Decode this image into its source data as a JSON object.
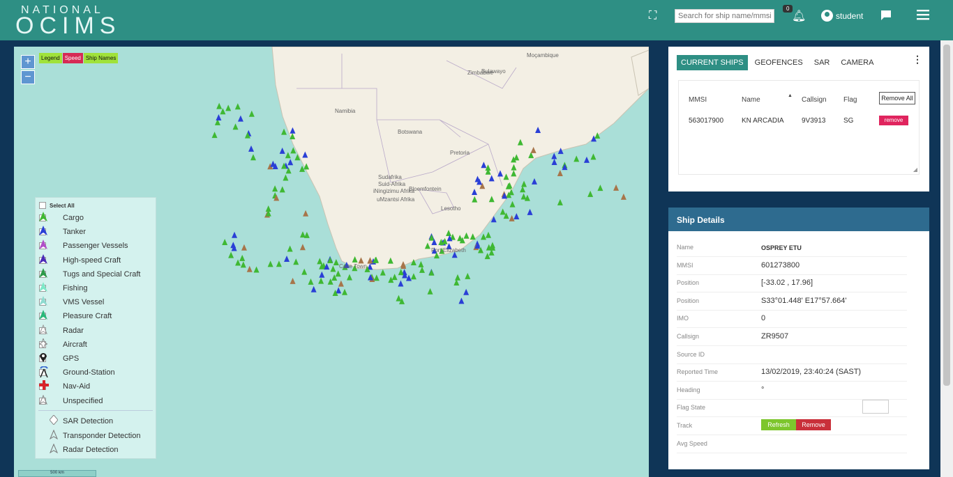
{
  "header": {
    "logo_top": "NATIONAL",
    "logo_main": "OCIMS",
    "search_placeholder": "Search for ship name/mmsi",
    "notification_count": "0",
    "user_name": "student",
    "colors": {
      "header": "#2e8f84",
      "sidebar": "#0f3557"
    }
  },
  "map": {
    "zoom_in": "+",
    "zoom_out": "−",
    "tags": {
      "legend": "Legend",
      "speed": "Speed",
      "ship_names": "Ship Names"
    },
    "scale": "500 km",
    "legend": {
      "select_all": "Select All",
      "items": [
        {
          "label": "Cargo",
          "color": "#3fb833",
          "icon": "triangle"
        },
        {
          "label": "Tanker",
          "color": "#2a3fd6",
          "icon": "triangle"
        },
        {
          "label": "Passenger Vessels",
          "color": "#b04fc8",
          "icon": "triangle"
        },
        {
          "label": "High-speed Craft",
          "color": "#4b2bb8",
          "icon": "triangle"
        },
        {
          "label": "Tugs and Special Craft",
          "color": "#2e9a4a",
          "icon": "triangle"
        },
        {
          "label": "Fishing",
          "color": "#7ee8c8",
          "icon": "triangle"
        },
        {
          "label": "VMS Vessel",
          "color": "#8fdbd0",
          "icon": "triangle"
        },
        {
          "label": "Pleasure Craft",
          "color": "#2ab87a",
          "icon": "triangle"
        },
        {
          "label": "Radar",
          "color": "#999999",
          "icon": "triangle-outline"
        },
        {
          "label": "Aircraft",
          "color": "#888888",
          "icon": "aircraft"
        },
        {
          "label": "GPS",
          "color": "#222222",
          "icon": "pin"
        },
        {
          "label": "Ground-Station",
          "color": "#3a6cd1",
          "icon": "antenna"
        },
        {
          "label": "Nav-Aid",
          "color": "#d8232a",
          "icon": "cross"
        },
        {
          "label": "Unspecified",
          "color": "#888888",
          "icon": "triangle-outline"
        }
      ],
      "detections": [
        {
          "label": "SAR Detection",
          "icon": "diamond"
        },
        {
          "label": "Transponder Detection",
          "icon": "triangle-outline"
        },
        {
          "label": "Radar Detection",
          "icon": "triangle-outline"
        }
      ]
    },
    "place_labels": [
      "Namibia",
      "Botswana",
      "Zimbabwe",
      "Moçambique",
      "Sudafrika",
      "Suid-Afrika",
      "iNingizimu Afrika",
      "uMzantsi Afrika",
      "Lesotho",
      "Pretoria",
      "Bloemfontein",
      "Bulawayo",
      "Port Elizabeth",
      "Cape Town"
    ]
  },
  "ships_panel": {
    "tabs": [
      "CURRENT SHIPS",
      "GEOFENCES",
      "SAR",
      "CAMERA"
    ],
    "columns": [
      "MMSI",
      "Name",
      "Callsign",
      "Flag"
    ],
    "remove_all": "Remove All",
    "rows": [
      {
        "mmsi": "563017900",
        "name": "KN ARCADIA",
        "callsign": "9V3913",
        "flag": "SG",
        "action": "remove"
      }
    ]
  },
  "details": {
    "title": "Ship Details",
    "fields": [
      {
        "label": "Name",
        "value": "OSPREY ETU"
      },
      {
        "label": "MMSI",
        "value": "601273800"
      },
      {
        "label": "Position",
        "value": "[-33.02 , 17.96]"
      },
      {
        "label": "Position",
        "value": "S33°01.448' E17°57.664'"
      },
      {
        "label": "IMO",
        "value": "0"
      },
      {
        "label": "Callsign",
        "value": "ZR9507"
      },
      {
        "label": "Source ID",
        "value": ""
      },
      {
        "label": "Reported Time",
        "value": "13/02/2019, 23:40:24 (SAST)"
      },
      {
        "label": "Heading",
        "value": "°"
      },
      {
        "label": "Flag State",
        "value": ""
      },
      {
        "label": "Track",
        "value": ""
      },
      {
        "label": "Avg Speed",
        "value": ""
      }
    ],
    "track_refresh": "Refresh",
    "track_remove": "Remove"
  }
}
